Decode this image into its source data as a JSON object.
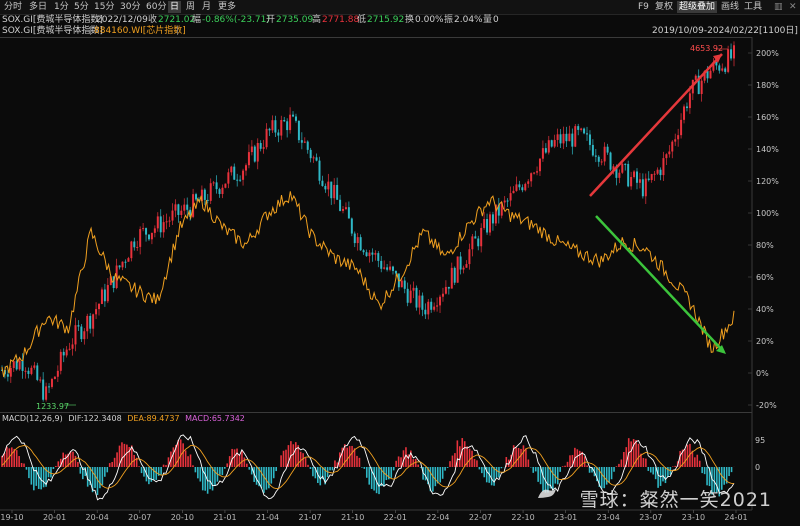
{
  "toolbar": {
    "timeframes": [
      "分时",
      "多日",
      "1分",
      "5分",
      "15分",
      "30分",
      "60分",
      "日",
      "周",
      "月",
      "更多"
    ],
    "active_timeframe": "日",
    "right_items": [
      "F9",
      "复权",
      "超级叠加",
      "画线",
      "工具"
    ],
    "active_right": "超级叠加"
  },
  "info_bar": {
    "symbol": "SOX.GI[费城半导体指数]",
    "date": "2022/12/09",
    "close_label": "收",
    "close": "2721.02",
    "change_label": "幅",
    "change": "-0.86%(-23.71)",
    "open_label": "开",
    "open": "2735.09",
    "high_label": "高",
    "high": "2771.88",
    "low_label": "低",
    "low": "2715.92",
    "turnover_label": "换",
    "turnover": "0.00%",
    "amplitude_label": "振",
    "amplitude": "2.04%",
    "volume_label": "量",
    "volume": "0"
  },
  "legend": {
    "main": "SOX.GI[费城半导体指数]",
    "overlay": "884160.WI[芯片指数]",
    "range": "2019/10/09-2024/02/22[1100日]"
  },
  "macd": {
    "label": "MACD(12,26,9)",
    "dif_label": "DIF:",
    "dif": "122.3408",
    "dea_label": "DEA:",
    "dea": "89.4737",
    "macd_label": "MACD:",
    "macd": "65.7342"
  },
  "annotations": {
    "high": "4653.92",
    "low": "1233.97"
  },
  "watermark": "雪球：粲然一笑2021",
  "colors": {
    "up": "#e8323c",
    "down": "#2fb8c6",
    "overlay": "#f0a020",
    "arrow_red": "#e5383b",
    "arrow_green": "#3cc43c",
    "high_text": "#ff4d4d",
    "low_text": "#5ad86a"
  },
  "chart_data": [
    {
      "type": "line",
      "title": "SOX.GI vs 884160.WI",
      "x": [
        "19-10",
        "20-01",
        "20-04",
        "20-07",
        "20-10",
        "21-01",
        "21-04",
        "21-07",
        "21-10",
        "22-01",
        "22-04",
        "22-07",
        "22-10",
        "23-01",
        "23-04",
        "23-07",
        "23-10",
        "24-01"
      ],
      "y_ticks": [
        "200%",
        "180%",
        "160%",
        "140%",
        "120%",
        "100%",
        "80%",
        "60%",
        "40%",
        "20%",
        "0%",
        "-20%"
      ],
      "ylim": [
        -20,
        200
      ],
      "series": [
        {
          "name": "SOX.GI[费城半导体指数]",
          "style": "candlestick",
          "values_pct": [
            2,
            8,
            -14,
            18,
            35,
            58,
            85,
            92,
            100,
            108,
            120,
            130,
            150,
            158,
            135,
            110,
            85,
            70,
            55,
            40,
            55,
            75,
            95,
            110,
            130,
            145,
            148,
            138,
            125,
            115,
            135,
            175,
            190,
            198
          ]
        },
        {
          "name": "884160.WI[芯片指数]",
          "style": "line",
          "values_pct": [
            0,
            12,
            35,
            28,
            88,
            60,
            52,
            45,
            90,
            108,
            90,
            80,
            100,
            112,
            85,
            72,
            65,
            42,
            62,
            88,
            72,
            92,
            108,
            98,
            92,
            82,
            75,
            70,
            82,
            78,
            62,
            45,
            15,
            35
          ]
        }
      ],
      "annotations": [
        {
          "text": "4653.92",
          "kind": "high"
        },
        {
          "text": "1233.97",
          "kind": "low"
        }
      ]
    },
    {
      "type": "bar",
      "title": "MACD(12,26,9)",
      "y_ticks": [
        "95",
        "0"
      ],
      "series": [
        {
          "name": "DIF",
          "value": 122.3408
        },
        {
          "name": "DEA",
          "value": 89.4737
        },
        {
          "name": "MACD",
          "value": 65.7342
        }
      ]
    }
  ]
}
